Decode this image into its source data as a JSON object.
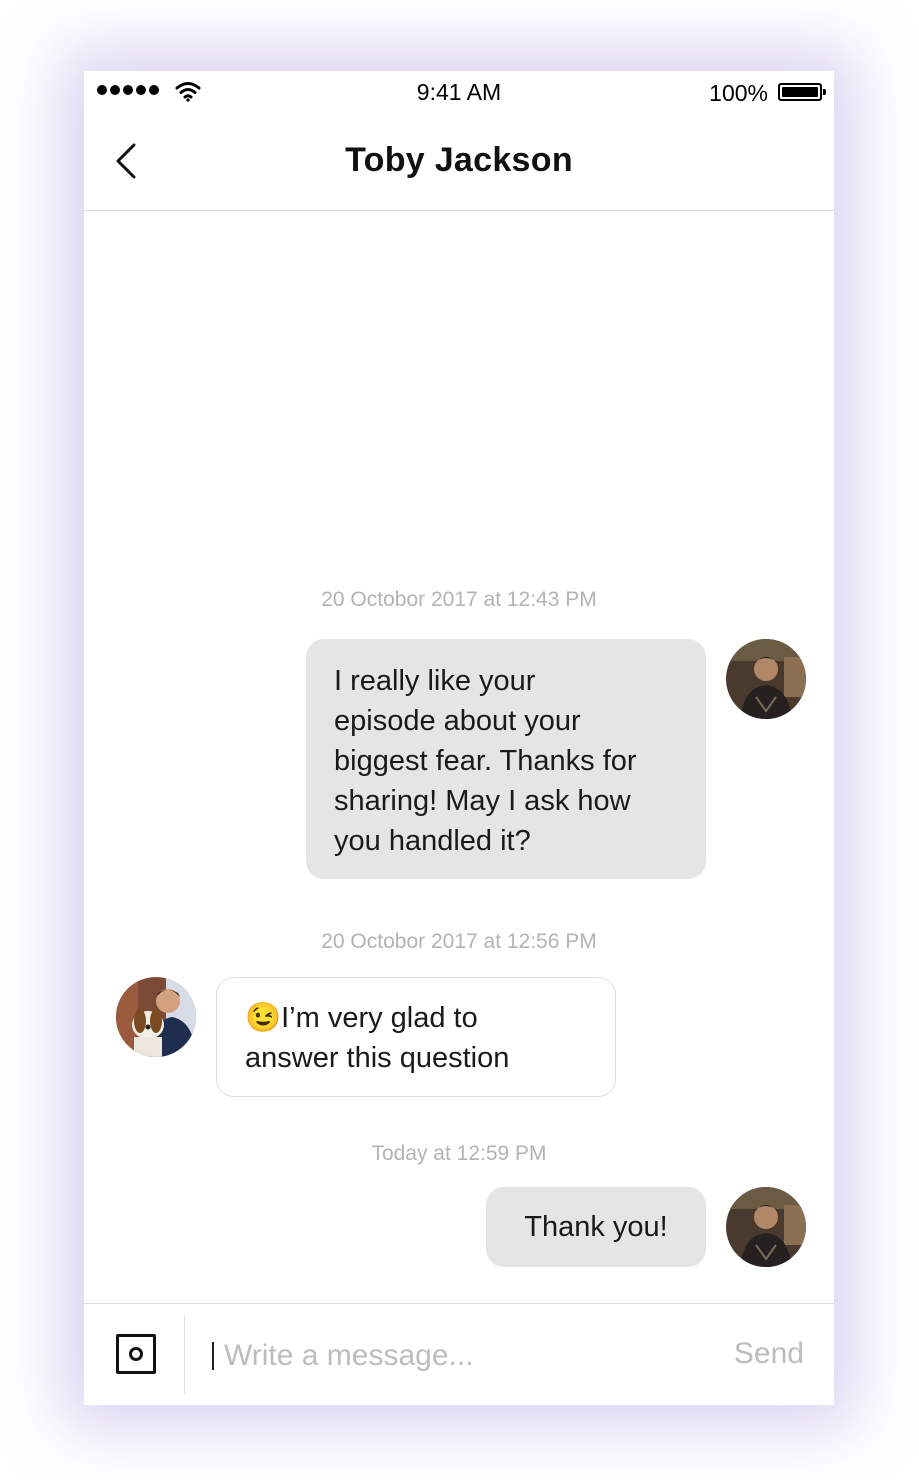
{
  "status_bar": {
    "time": "9:41 AM",
    "battery": "100%"
  },
  "header": {
    "title": "Toby Jackson"
  },
  "messages": [
    {
      "timestamp": "20 Octobor 2017 at 12:43 PM",
      "direction": "outgoing",
      "lines": [
        "I really like your",
        "episode about your",
        "biggest fear. Thanks for",
        "sharing! May I ask how",
        "you handled it?"
      ]
    },
    {
      "timestamp": "20 Octobor 2017 at 12:56 PM",
      "direction": "incoming",
      "emoji": "😉",
      "lines": [
        "I’m very glad to",
        "answer this question"
      ]
    },
    {
      "timestamp": "Today at 12:59 PM",
      "direction": "outgoing",
      "lines": [
        "Thank you!"
      ]
    }
  ],
  "composer": {
    "placeholder": "Write a message...",
    "send_label": "Send"
  },
  "colors": {
    "outgoing_bubble": "#e5e5e5",
    "timestamp_text": "#b3b3b3",
    "placeholder_text": "#bdbdbd"
  },
  "icons": {
    "back": "chevron-left-icon",
    "camera": "camera-icon",
    "wifi": "wifi-icon",
    "battery": "battery-icon"
  }
}
